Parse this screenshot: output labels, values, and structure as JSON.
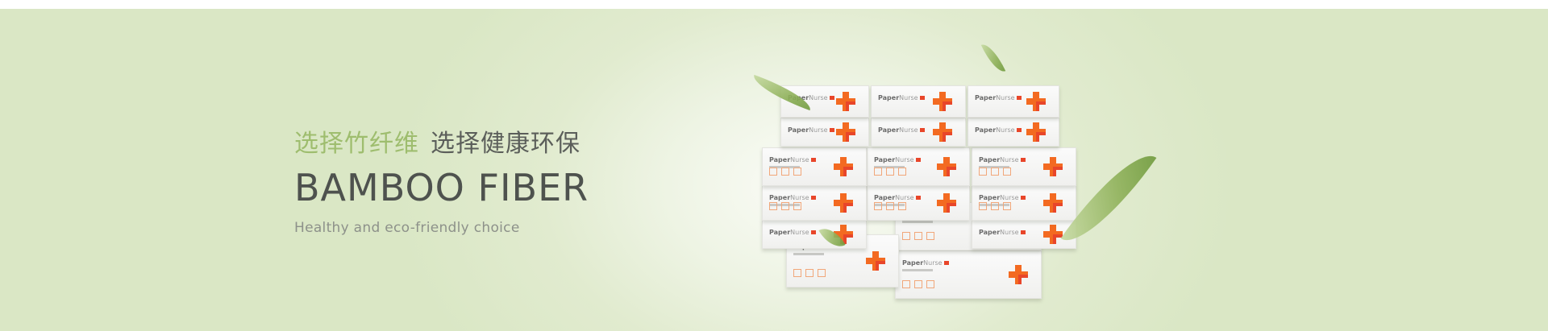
{
  "banner": {
    "title_zh_highlight": "选择竹纤维",
    "title_zh_rest": "选择健康环保",
    "title_en": "BAMBOO FIBER",
    "subtitle": "Healthy and eco-friendly choice"
  },
  "product": {
    "brand_bold": "Paper",
    "brand_light": "Nurse"
  },
  "colors": {
    "accent_green": "#9ebd6e",
    "cross_orange": "#f36a21",
    "cross_red": "#e8462a"
  }
}
